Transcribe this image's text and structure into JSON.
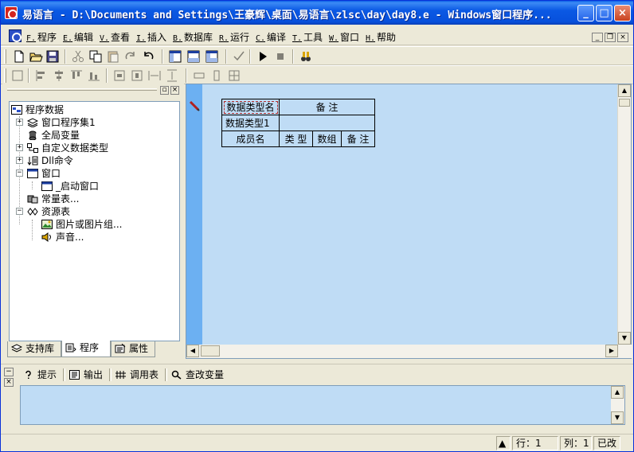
{
  "window": {
    "title": "易语言 - D:\\Documents and Settings\\王豪辉\\桌面\\易语言\\zlsc\\day\\day8.e - Windows窗口程序...",
    "minimize": "_",
    "maximize": "□",
    "close": "×"
  },
  "menu": {
    "items": [
      {
        "key": "F.",
        "label": "程序"
      },
      {
        "key": "E.",
        "label": "编辑"
      },
      {
        "key": "V.",
        "label": "查看"
      },
      {
        "key": "I.",
        "label": "插入"
      },
      {
        "key": "B.",
        "label": "数据库"
      },
      {
        "key": "R.",
        "label": "运行"
      },
      {
        "key": "C.",
        "label": "编译"
      },
      {
        "key": "T.",
        "label": "工具"
      },
      {
        "key": "W.",
        "label": "窗口"
      },
      {
        "key": "H.",
        "label": "帮助"
      }
    ],
    "mdi_min": "_",
    "mdi_restore": "❐",
    "mdi_close": "×"
  },
  "tree": {
    "root": "程序数据",
    "items": [
      {
        "label": "窗口程序集1",
        "icon": "stack-icon"
      },
      {
        "label": "全局变量",
        "icon": "database-icon"
      },
      {
        "label": "自定义数据类型",
        "icon": "datatype-icon"
      },
      {
        "label": "Dll命令",
        "icon": "dll-icon"
      },
      {
        "label": "窗口",
        "icon": "window-icon"
      },
      {
        "label": "_启动窗口",
        "icon": "window-icon"
      },
      {
        "label": "常量表...",
        "icon": "constants-icon"
      },
      {
        "label": "资源表",
        "icon": "resources-icon"
      },
      {
        "label": "图片或图片组...",
        "icon": "picture-icon"
      },
      {
        "label": "声音...",
        "icon": "sound-icon"
      }
    ]
  },
  "panel_tabs": [
    {
      "label": "支持库",
      "icon": "library-icon"
    },
    {
      "label": "程序",
      "icon": "program-icon"
    },
    {
      "label": "属性",
      "icon": "properties-icon"
    }
  ],
  "datatype_table": {
    "header_name": "数据类型名",
    "header_remark": "备 注",
    "type_name": "数据类型1",
    "type_remark": "",
    "member_columns": [
      "成员名",
      "类 型",
      "数组",
      "备 注"
    ]
  },
  "bottom_tabs": [
    {
      "label": "提示",
      "icon": "hint-icon"
    },
    {
      "label": "输出",
      "icon": "output-icon"
    },
    {
      "label": "调用表",
      "icon": "calltable-icon"
    },
    {
      "label": "查改变量",
      "icon": "magnifier-icon"
    }
  ],
  "status": {
    "row": "行：1",
    "col": "列：1",
    "modified": "已改"
  },
  "colors": {
    "editor_bg": "#bfdcf5",
    "gutter": "#6cb0f2",
    "titlebar": "#0b59e4"
  }
}
